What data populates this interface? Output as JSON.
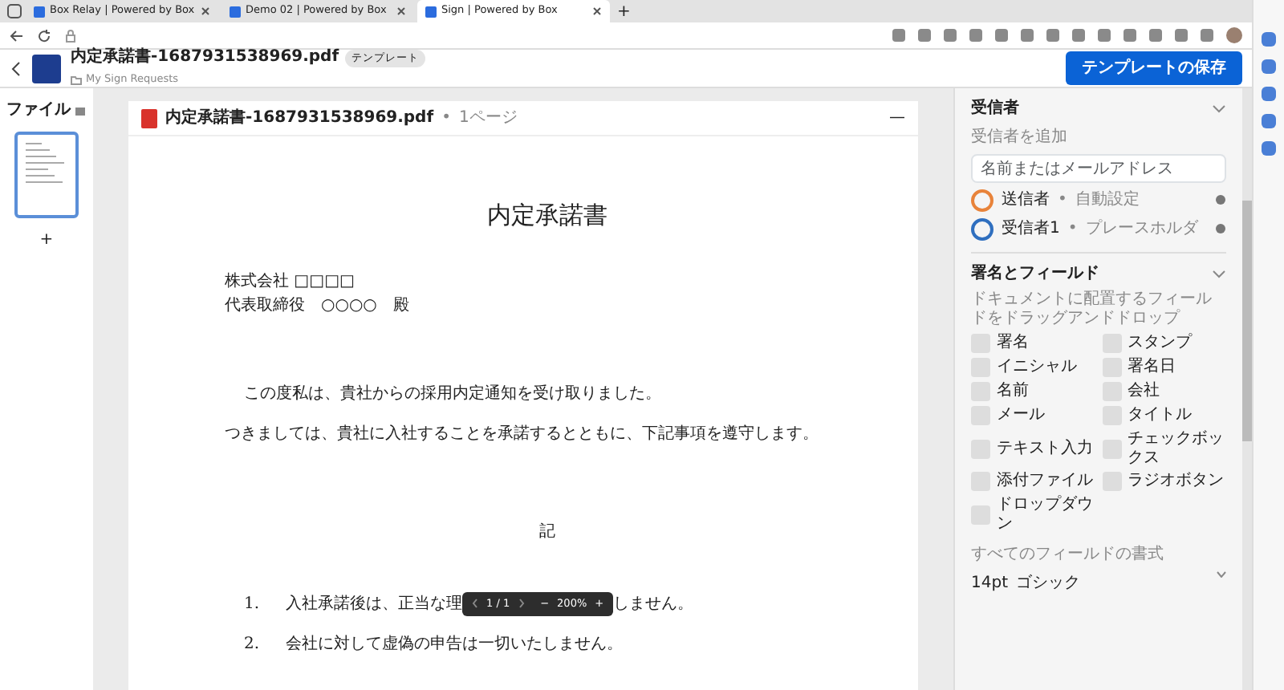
{
  "browser": {
    "tabs": [
      {
        "title": "Box Relay | Powered by Box",
        "selected": false
      },
      {
        "title": "Demo 02 | Powered by Box",
        "selected": false
      },
      {
        "title": "Sign | Powered by Box",
        "selected": true
      }
    ],
    "new_tab": "+"
  },
  "app": {
    "title": "内定承諾書-1687931538969.pdf",
    "badge": "テンプレート",
    "breadcrumb": "My Sign Requests",
    "save_button": "テンプレートの保存"
  },
  "files_panel": {
    "title": "ファイル",
    "add": "+"
  },
  "document": {
    "name": "内定承諾書-1687931538969.pdf",
    "separator": "•",
    "pages": "1ページ",
    "menu": "—",
    "title": "内定承諾書",
    "addressee": [
      "株式会社 □□□□",
      "代表取締役　○○○○　殿"
    ],
    "body": [
      "この度私は、貴社からの採用内定通知を受け取りました。",
      "つきましては、貴社に入社することを承諾するとともに、下記事項を遵守します。"
    ],
    "heading": "記",
    "items": [
      {
        "number": "1.",
        "text_before": "入社承諾後は、正当な理",
        "text_after": "しません。"
      },
      {
        "number": "2.",
        "text_before": "会社に対して虚偽の申告は一切いたしません。"
      }
    ]
  },
  "viewer_toolbar": {
    "page": "1 / 1",
    "zoom_out": "−",
    "zoom": "200%",
    "zoom_in": "+"
  },
  "recipients": {
    "title": "受信者",
    "add_label": "受信者を追加",
    "placeholder": "名前またはメールアドレス",
    "separator": "•",
    "items": [
      {
        "name": "送信者",
        "detail": "自動設定",
        "color": "#e8833a"
      },
      {
        "name": "受信者1",
        "detail": "プレースホルダ",
        "color": "#2f6fbf"
      }
    ]
  },
  "fields": {
    "title": "署名とフィールド",
    "description": "ドキュメントに配置するフィールドをドラッグアンドドロップ",
    "items": [
      "署名",
      "スタンプ",
      "イニシャル",
      "署名日",
      "名前",
      "会社",
      "メール",
      "タイトル",
      "テキスト入力",
      "チェックボックス",
      "添付ファイル",
      "ラジオボタン",
      "ドロップダウン"
    ],
    "format_label": "すべてのフィールドの書式",
    "size": "14pt",
    "font": "ゴシック"
  }
}
